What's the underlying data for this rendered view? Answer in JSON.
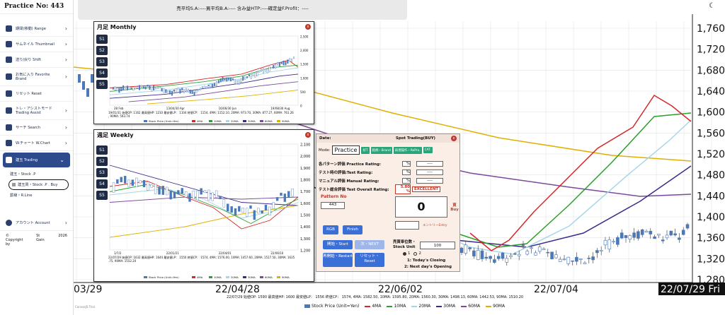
{
  "sidebar": {
    "title": "Practice No: 443",
    "items": [
      {
        "label": "期間(移動) Range"
      },
      {
        "label": "サムネイル Thumbnail"
      },
      {
        "label": "送り/戻り Shift"
      },
      {
        "label": "お気に入り Favorite   Brand"
      },
      {
        "label": "リセット Reset"
      },
      {
        "label": "トレ・アシストモード Trading Assist"
      },
      {
        "label": "サーチ Search"
      },
      {
        "label": "W.チャート W.Chart"
      },
      {
        "label": "建玉 Trading"
      }
    ],
    "subitems": [
      "建玉・Stock .P",
      "建玉買・Stock .P . Buy",
      "罫線・R.Line"
    ],
    "account": "アカウント Account",
    "copyright": "© Copyright by",
    "brand": "St Gain",
    "year": "2026"
  },
  "topbar": {
    "text": "売平均S.A:----買平均B.A:---- 含み益HTP:----確定益F.Profit：----"
  },
  "main_chart": {
    "y_ticks": [
      "1,760",
      "1,720",
      "1,680",
      "1,640",
      "1,600",
      "1,560",
      "1,520",
      "1,480",
      "1,440",
      "1,400",
      "1,360",
      "1,320",
      "1,280"
    ],
    "x_labels": [
      "03/29",
      "22/04/28",
      "22/06/02",
      "22/07/04"
    ],
    "current_date": "22/07/29 Fri",
    "info_line": "22/07/29 始値OP: 1590 最高値HP: 1600 最安値LP： 1556 終値CP： 1574, 4MA: 1582.50, 10MA: 1595.80, 20MA: 1560.30, 30MA: 1498.13, 60MA: 1442.53, 90MA: 1510.20",
    "legend": [
      "Stock Price (Unit=Yen)",
      "4MA",
      "10MA",
      "20MA",
      "30MA",
      "60MA",
      "90MA"
    ],
    "canvas_note": "CanvasJS Trial",
    "colors": {
      "4MA": "#d62728",
      "10MA": "#2ca02c",
      "20MA": "#a6d6ea",
      "30MA": "#3b2a8c",
      "60MA": "#7a4a9c",
      "90MA": "#e0b000",
      "candle": "#4a78b8"
    }
  },
  "monthly": {
    "title": "月足 Monthly",
    "buttons": [
      "S1",
      "S2",
      "S3",
      "S4",
      "S5"
    ],
    "y_ticks": [
      "2,500",
      "2,000",
      "1,500",
      "1,000",
      "500",
      "0"
    ],
    "x_labels": [
      "28 Feb",
      "13/04/30 Apr",
      "16/06/30 Jun",
      "19/08/30 Aug"
    ],
    "info": "19/01/31 始値OP: 1162 最高値HP: 1210 最安値LP： 1104 終値CP： 1154, 4MA: 1152.10, 20MA: 973.70, 30MA: 877.27, 60MA: 761.26, 90MA: 593.74",
    "legend": [
      "Stock Price (Unit=Yen)",
      "4MA",
      "10MA",
      "20MA",
      "30MA",
      "60MA",
      "90MA"
    ]
  },
  "weekly": {
    "title": "週足 Weekly",
    "buttons": [
      "S1",
      "S2",
      "S3",
      "S4",
      "S5"
    ],
    "y_ticks": [
      "2,100",
      "2,000",
      "1,900",
      "1,800",
      "1,700",
      "1,600",
      "1,500",
      "1,400",
      "1,300",
      "1,200"
    ],
    "x_labels": [
      "1/7/2",
      "22/01/21",
      "22/04/01",
      "22/06/10"
    ],
    "info": "22/07/29 始値OP: 1632 最高値HP: 1644 最安値LP： 1550 終値CP： 1574, 4MA: 1576.00, 10MA: 1457.60, 20MA: 1517.50, 30MA: 1635.75, 90MA: 1552.20",
    "legend": [
      "Stock Price (Unit=Yen)",
      "4MA",
      "10MA",
      "20MA",
      "30MA",
      "60MA",
      "90MA"
    ]
  },
  "trade": {
    "date_label": "Date:",
    "title": "Spot Trading(BUY)",
    "mode_label": "Mode:",
    "practice": "Practice",
    "tags": [
      "好T",
      "銘柄・Brand",
      "再現操作・RePro.",
      "CAT."
    ],
    "ratings": [
      {
        "label": "各パターン評価 Practice Rating:",
        "pct": "%",
        "val": "----"
      },
      {
        "label": "テスト時の評価:Test Rating:",
        "pct": "%",
        "val": "----"
      },
      {
        "label": "マニュアル評価 Manual Rating:",
        "pct": "%",
        "val": "----"
      },
      {
        "label": "テスト総合評価 Test Overall Rating:",
        "pct": "5.80 %",
        "val": "EXCELLENT"
      }
    ],
    "pattern_label": "Pattern No",
    "pattern_no": "443",
    "big_value": "0",
    "buy_label": "買 Buy",
    "entry_label": "エントリーEntry",
    "rgb": "RGB",
    "finish": "Finish",
    "start": "開始・Start",
    "next": "次・NEXT",
    "restart": "再開始・Restart",
    "reset": "リセット・Reset",
    "unit_label": "売買単位数・Stock Unit",
    "unit_value": "100",
    "radio1": "1",
    "radio2": "2",
    "closing": "1: Today's Closing",
    "opening": "2: Next day's Opening"
  }
}
